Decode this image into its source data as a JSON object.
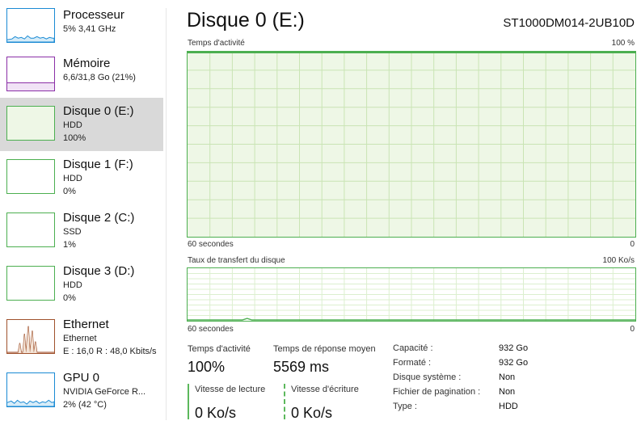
{
  "sidebar": {
    "items": [
      {
        "title": "Processeur",
        "line1": "5% 3,41 GHz",
        "line2": "",
        "color": "#1a8ad4"
      },
      {
        "title": "Mémoire",
        "line1": "6,6/31,8 Go (21%)",
        "line2": "",
        "color": "#8b2fa7"
      },
      {
        "title": "Disque 0 (E:)",
        "line1": "HDD",
        "line2": "100%",
        "color": "#4caf50"
      },
      {
        "title": "Disque 1 (F:)",
        "line1": "HDD",
        "line2": "0%",
        "color": "#4caf50"
      },
      {
        "title": "Disque 2 (C:)",
        "line1": "SSD",
        "line2": "1%",
        "color": "#4caf50"
      },
      {
        "title": "Disque 3 (D:)",
        "line1": "HDD",
        "line2": "0%",
        "color": "#4caf50"
      },
      {
        "title": "Ethernet",
        "line1": "Ethernet",
        "line2": "E : 16,0  R : 48,0 Kbits/s",
        "color": "#a0522d"
      },
      {
        "title": "GPU 0",
        "line1": "NVIDIA GeForce R...",
        "line2": "2% (42 °C)",
        "color": "#1a8ad4"
      }
    ]
  },
  "main": {
    "title": "Disque 0 (E:)",
    "model": "ST1000DM014-2UB10D",
    "activity_graph": {
      "label": "Temps d'activité",
      "max_label": "100 %",
      "time_label": "60 secondes",
      "min_label": "0",
      "value_percent": 100
    },
    "transfer_graph": {
      "label": "Taux de transfert du disque",
      "max_label": "100 Ko/s",
      "time_label": "60 secondes",
      "min_label": "0"
    },
    "stats": {
      "activity_label": "Temps d'activité",
      "activity_value": "100%",
      "response_label": "Temps de réponse moyen",
      "response_value": "5569 ms",
      "read_label": "Vitesse de lecture",
      "read_value": "0 Ko/s",
      "write_label": "Vitesse d'écriture",
      "write_value": "0 Ko/s"
    },
    "properties": [
      {
        "key": "Capacité :",
        "value": "932 Go"
      },
      {
        "key": "Formaté :",
        "value": "932 Go"
      },
      {
        "key": "Disque système :",
        "value": "Non"
      },
      {
        "key": "Fichier de pagination :",
        "value": "Non"
      },
      {
        "key": "Type :",
        "value": "HDD"
      }
    ]
  },
  "colors": {
    "disk_accent": "#4caf50",
    "disk_fill": "#eef7e6",
    "selected_bg": "#d9d9d9"
  }
}
